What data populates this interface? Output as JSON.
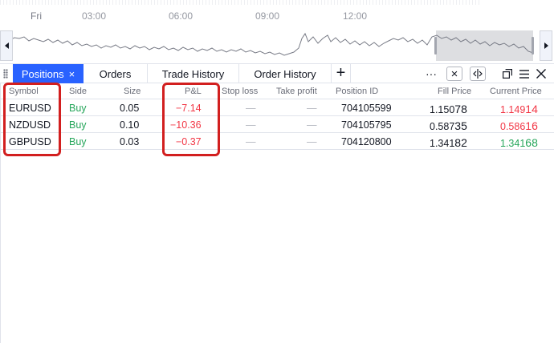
{
  "time_axis": {
    "labels": [
      "Fri",
      "03:00",
      "06:00",
      "09:00",
      "12:00"
    ]
  },
  "tabs": [
    {
      "label": "Positions",
      "active": true,
      "close_icon": "×"
    },
    {
      "label": "Orders"
    },
    {
      "label": "Trade History"
    },
    {
      "label": "Order History"
    }
  ],
  "toolbar": {
    "add_label": "+",
    "more_label": "···",
    "close_label": "×",
    "split_icon": "split-view-icon",
    "popout_icon": "popout-icon",
    "menu_icon": "hamburger-menu-icon",
    "panel_close_icon": "close-icon"
  },
  "table": {
    "columns": [
      "Symbol",
      "Side",
      "Size",
      "P&L",
      "Stop loss",
      "Take profit",
      "Position ID",
      "Fill Price",
      "Current Price"
    ],
    "rows": [
      {
        "symbol": "EURUSD",
        "side": "Buy",
        "size": "0.05",
        "pnl": "−7.14",
        "stop_loss": "—",
        "take_profit": "—",
        "position_id": "704105599",
        "fill_main": "1.150",
        "fill_big": "78",
        "cur_main": "1.149",
        "cur_big": "14",
        "cur_color": "red"
      },
      {
        "symbol": "NZDUSD",
        "side": "Buy",
        "size": "0.10",
        "pnl": "−10.36",
        "stop_loss": "—",
        "take_profit": "—",
        "position_id": "704105795",
        "fill_main": "0.587",
        "fill_big": "35",
        "cur_main": "0.586",
        "cur_big": "16",
        "cur_color": "red"
      },
      {
        "symbol": "GBPUSD",
        "side": "Buy",
        "size": "0.03",
        "pnl": "−0.37",
        "stop_loss": "—",
        "take_profit": "—",
        "position_id": "704120800",
        "fill_main": "1.341",
        "fill_big": "82",
        "cur_main": "1.341",
        "cur_big": "68",
        "cur_color": "green"
      }
    ]
  },
  "colors": {
    "accent": "#2962ff",
    "buy": "#26a65b",
    "loss": "#f23645",
    "highlight": "#d21f1f"
  }
}
